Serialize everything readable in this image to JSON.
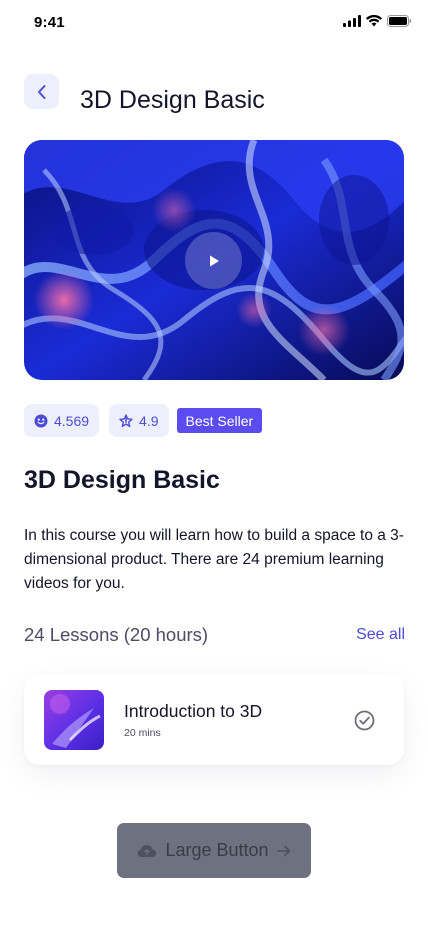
{
  "status_bar": {
    "time": "9:41",
    "icons": [
      "signal-icon",
      "wifi-icon",
      "battery-icon"
    ]
  },
  "header": {
    "back_icon": "chevron-left-icon",
    "title": "3D Design Basic"
  },
  "hero": {
    "image": "abstract-blue-3d-shapes",
    "play_icon": "play-icon"
  },
  "badges": {
    "students_icon": "smile-icon",
    "students": "4.569",
    "rating_icon": "star-icon",
    "rating": "4.9",
    "best_seller": "Best Seller"
  },
  "course": {
    "title": "3D Design Basic",
    "description": "In this course you will learn how to build a space to a 3-dimensional product. There are 24 premium learning videos for you."
  },
  "lessons": {
    "heading": "24 Lessons (20 hours)",
    "see_all": "See all",
    "items": [
      {
        "title": "Introduction to 3D",
        "duration": "20 mins",
        "status_icon": "check-circle-icon",
        "completed": true
      }
    ]
  },
  "primary_button": {
    "label": "Large Button",
    "leading_icon": "cloud-icon",
    "trailing_icon": "arrow-right-icon"
  },
  "colors": {
    "accent": "#4E4BD8",
    "accent_light": "#EEEFFC",
    "badge_fill": "#5B4CF0",
    "text_primary": "#14142B",
    "text_secondary": "#4E4B66",
    "button_disabled": "#6E7280"
  }
}
